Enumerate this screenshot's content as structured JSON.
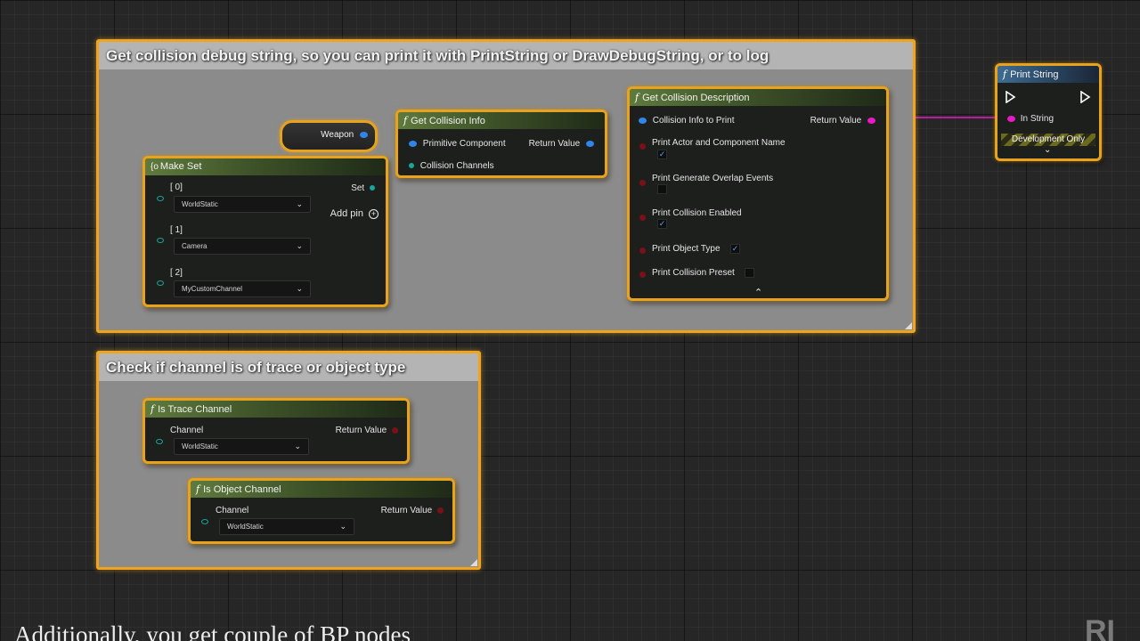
{
  "comments": {
    "collision": {
      "title": "Get collision debug string, so you can print it with PrintString or DrawDebugString, or to log"
    },
    "channel": {
      "title": "Check if channel is of trace or object type"
    }
  },
  "variable_weapon": {
    "label": "Weapon"
  },
  "make_set": {
    "title": "Make Set",
    "set_label": "Set",
    "add_pin_label": "Add pin",
    "entries": [
      {
        "index": "[ 0]",
        "value": "WorldStatic"
      },
      {
        "index": "[ 1]",
        "value": "Camera"
      },
      {
        "index": "[ 2]",
        "value": "MyCustomChannel"
      }
    ]
  },
  "get_collision_info": {
    "title": "Get Collision Info",
    "pin_primitive": "Primitive Component",
    "pin_channels": "Collision Channels",
    "pin_return": "Return Value"
  },
  "get_collision_description": {
    "title": "Get Collision Description",
    "pin_info": "Collision Info to Print",
    "pin_return": "Return Value",
    "options": [
      {
        "label": "Print Actor and Component Name",
        "checked": true
      },
      {
        "label": "Print Generate Overlap Events",
        "checked": false
      },
      {
        "label": "Print Collision Enabled",
        "checked": true
      },
      {
        "label": "Print Object Type",
        "checked": true
      },
      {
        "label": "Print Collision Preset",
        "checked": false
      }
    ]
  },
  "print_string": {
    "title": "Print String",
    "pin_in_string": "In String",
    "dev_only": "Development Only"
  },
  "is_trace_channel": {
    "title": "Is Trace Channel",
    "pin_channel": "Channel",
    "pin_return": "Return Value",
    "channel_value": "WorldStatic"
  },
  "is_object_channel": {
    "title": "Is Object Channel",
    "pin_channel": "Channel",
    "pin_return": "Return Value",
    "channel_value": "WorldStatic"
  },
  "caption": "Additionally, you get couple of BP nodes",
  "watermark": "RI",
  "colors": {
    "comment_border": "#f0a41e",
    "node_outline": "#e8a21c",
    "string_wire": "#e81ac8",
    "struct_wire": "#2f86e8",
    "set_wire": "#1aa59a"
  }
}
